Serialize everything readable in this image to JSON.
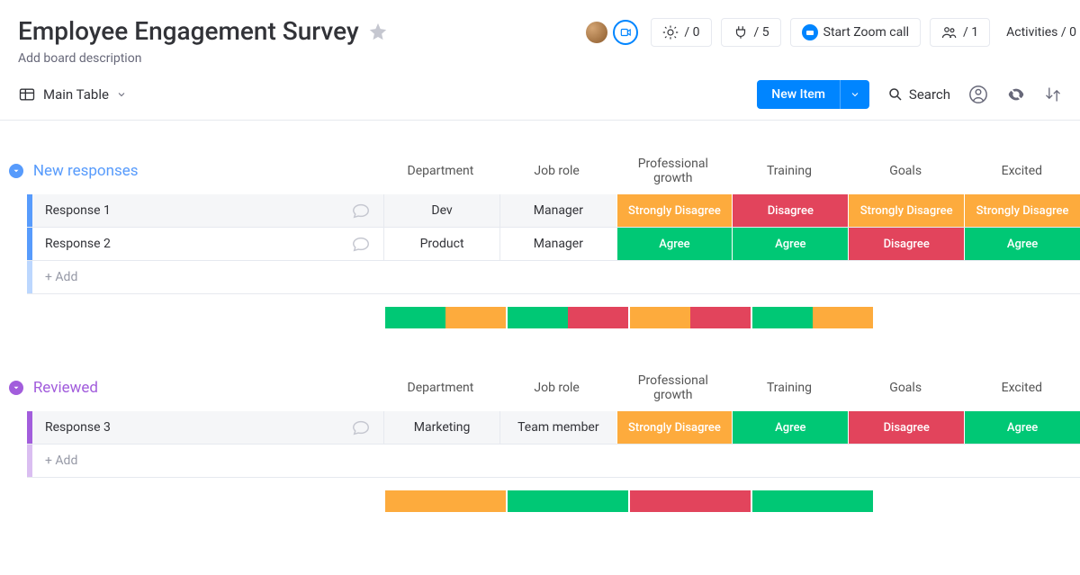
{
  "header": {
    "title": "Employee Engagement Survey",
    "description": "Add board description"
  },
  "top_controls": {
    "automations_count": "/ 0",
    "integrations_count": "/ 5",
    "zoom_label": "Start Zoom call",
    "members_count": "/ 1",
    "activities_label": "Activities / 0"
  },
  "view_bar": {
    "view_name": "Main Table",
    "new_item_label": "New Item",
    "search_label": "Search"
  },
  "columns": {
    "department": "Department",
    "job_role": "Job role",
    "professional_growth": "Professional growth",
    "training": "Training",
    "goals": "Goals",
    "excited": "Excited"
  },
  "status_labels": {
    "strongly_disagree": "Strongly Disagree",
    "disagree": "Disagree",
    "agree": "Agree"
  },
  "status_colors": {
    "strongly_disagree": "#fdab3d",
    "disagree": "#e2445c",
    "agree": "#00c875"
  },
  "add_row_label": "+ Add",
  "groups": [
    {
      "id": "new_responses",
      "title": "New responses",
      "color": "#579bfc",
      "rows": [
        {
          "name": "Response 1",
          "department": "Dev",
          "job_role": "Manager",
          "professional_growth": "strongly_disagree",
          "training": "disagree",
          "goals": "strongly_disagree",
          "excited": "strongly_disagree"
        },
        {
          "name": "Response 2",
          "department": "Product",
          "job_role": "Manager",
          "professional_growth": "agree",
          "training": "agree",
          "goals": "disagree",
          "excited": "agree"
        }
      ],
      "summary": {
        "professional_growth": [
          "agree",
          "strongly_disagree"
        ],
        "training": [
          "agree",
          "disagree"
        ],
        "goals": [
          "strongly_disagree",
          "disagree"
        ],
        "excited": [
          "agree",
          "strongly_disagree"
        ]
      }
    },
    {
      "id": "reviewed",
      "title": "Reviewed",
      "color": "#a25ddc",
      "rows": [
        {
          "name": "Response 3",
          "department": "Marketing",
          "job_role": "Team member",
          "professional_growth": "strongly_disagree",
          "training": "agree",
          "goals": "disagree",
          "excited": "agree"
        }
      ],
      "summary": {
        "professional_growth": [
          "strongly_disagree"
        ],
        "training": [
          "agree"
        ],
        "goals": [
          "disagree"
        ],
        "excited": [
          "agree"
        ]
      }
    }
  ]
}
